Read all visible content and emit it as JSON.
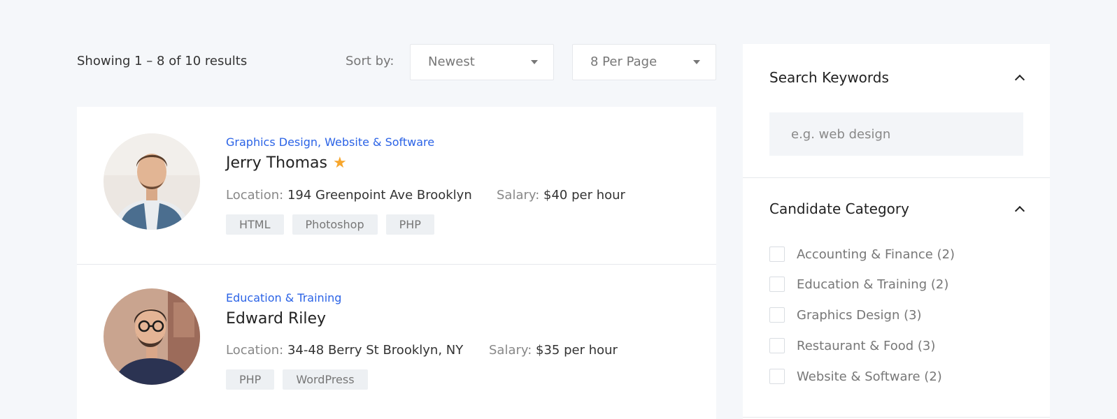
{
  "results": {
    "count_text": "Showing 1 – 8 of 10 results",
    "sort_label": "Sort by:",
    "sort_value": "Newest",
    "per_page_value": "8 Per Page"
  },
  "candidates": [
    {
      "cat1": "Graphics Design",
      "sep": ", ",
      "cat2": "Website & Software",
      "name": "Jerry Thomas",
      "featured_icon": "star-icon",
      "location_label": "Location:",
      "location": "194 Greenpoint Ave Brooklyn",
      "salary_label": "Salary:",
      "salary": "$40 per hour",
      "tags": [
        "HTML",
        "Photoshop",
        "PHP"
      ]
    },
    {
      "cat1": "Education & Training",
      "name": "Edward Riley",
      "location_label": "Location:",
      "location": "34-48 Berry St Brooklyn, NY",
      "salary_label": "Salary:",
      "salary": "$35 per hour",
      "tags": [
        "PHP",
        "WordPress"
      ]
    }
  ],
  "sidebar": {
    "search_title": "Search Keywords",
    "search_placeholder": "e.g. web design",
    "category_title": "Candidate Category",
    "categories": [
      "Accounting & Finance (2)",
      "Education & Training (2)",
      "Graphics Design (3)",
      "Restaurant & Food (3)",
      "Website & Software (2)"
    ]
  },
  "colors": {
    "accent": "#2b63e6",
    "star": "#f7a62c",
    "page_bg": "#f5f7fa"
  }
}
